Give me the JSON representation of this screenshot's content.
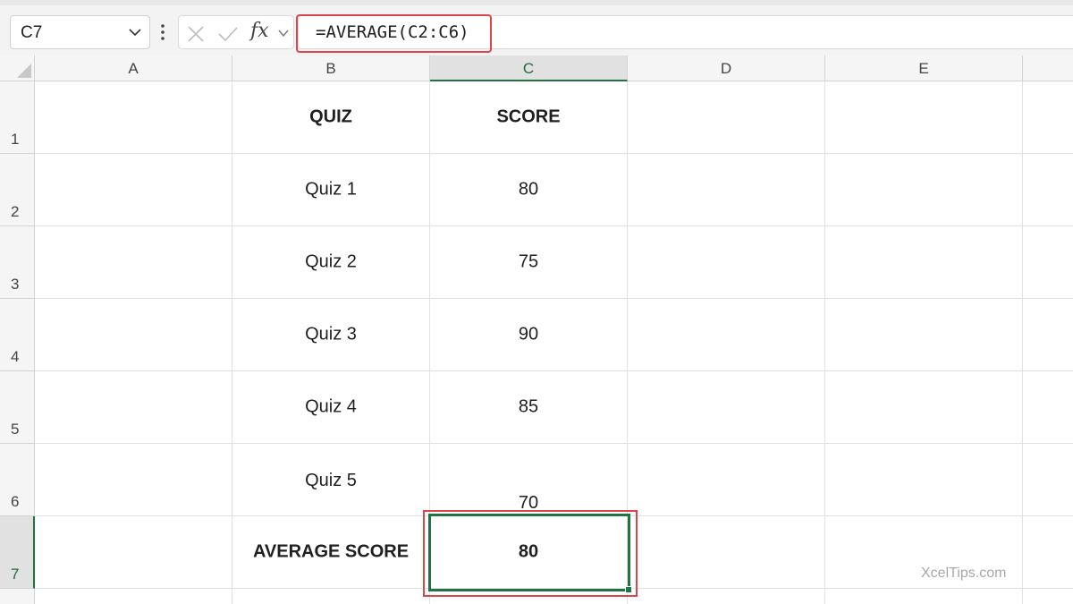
{
  "formula_bar": {
    "name_box": "C7",
    "fx_label": "fx",
    "formula": "=AVERAGE(C2:C6)"
  },
  "columns": [
    "A",
    "B",
    "C",
    "D",
    "E"
  ],
  "rows": [
    "1",
    "2",
    "3",
    "4",
    "5",
    "6",
    "7"
  ],
  "cells": {
    "B1": "QUIZ",
    "C1": "SCORE",
    "B2": "Quiz 1",
    "C2": "80",
    "B3": "Quiz 2",
    "C3": "75",
    "B4": "Quiz 3",
    "C4": "90",
    "B5": "Quiz 4",
    "C5": "85",
    "B6": "Quiz 5",
    "C6": "70",
    "B7": "AVERAGE SCORE",
    "C7": "80"
  },
  "selected_cell": "C7",
  "watermark": "XcelTips.com",
  "colors": {
    "selection": "#217346",
    "highlight": "#d9474a"
  }
}
